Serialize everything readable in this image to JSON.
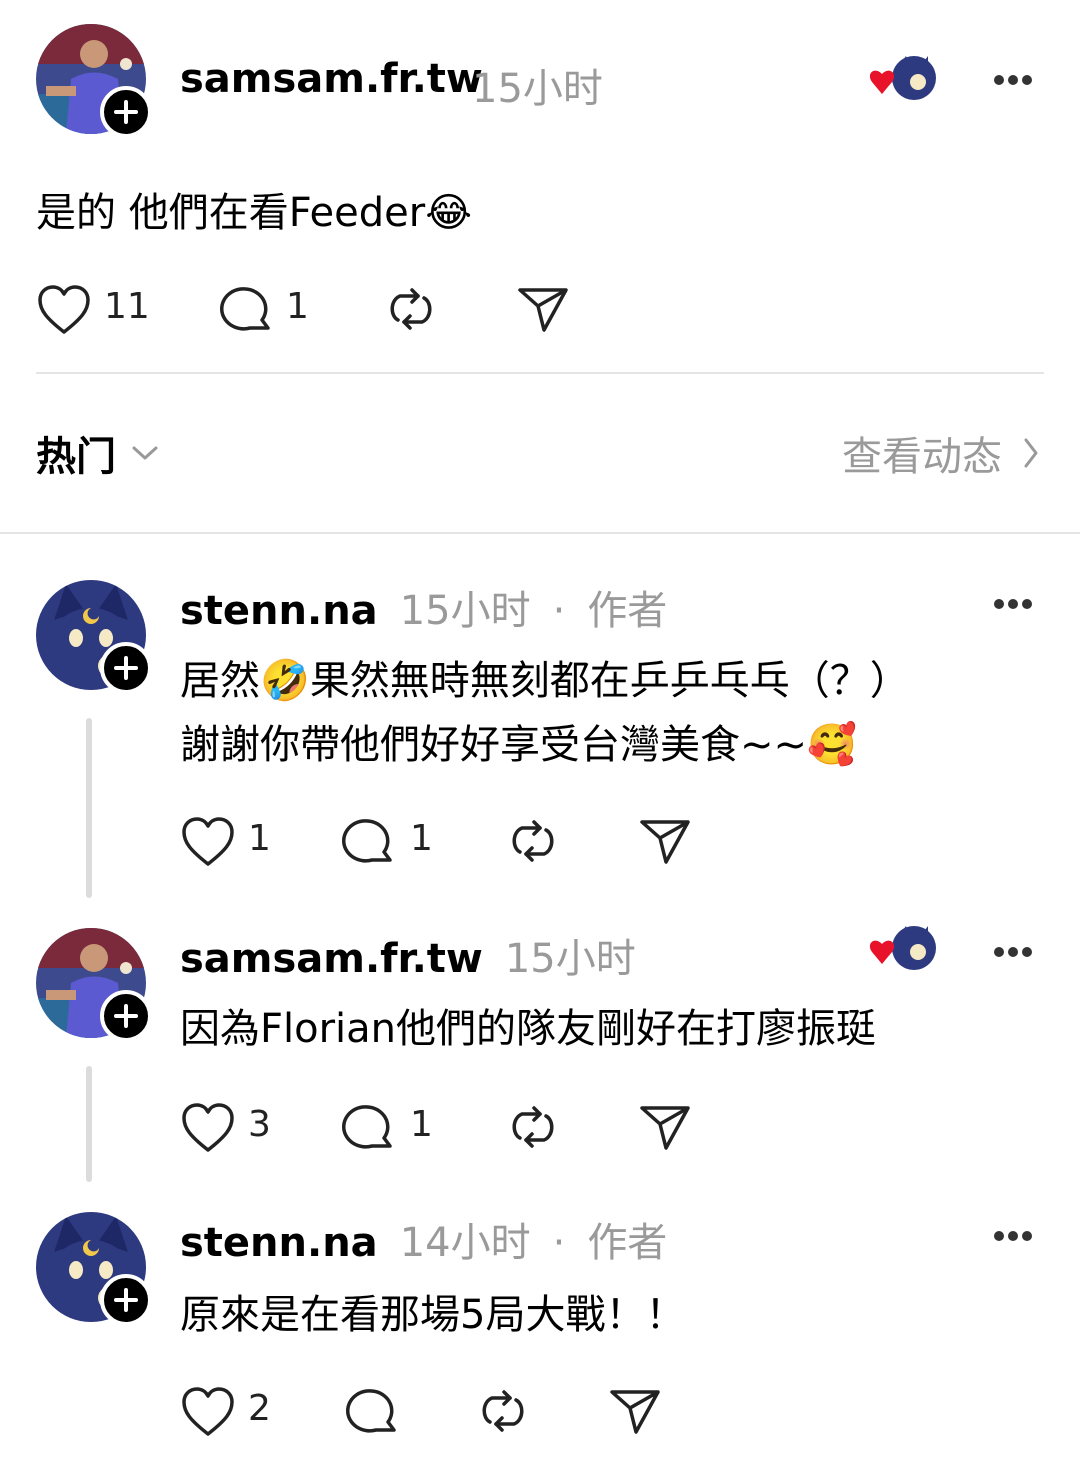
{
  "post": {
    "username": "samsam.fr.tw",
    "time": "15小时",
    "text": "是的 他們在看Feeder",
    "emoji": "😂",
    "likes": "11",
    "replies": "1"
  },
  "filter_bar": {
    "sort_label": "热门",
    "activity_label": "查看动态"
  },
  "comments": [
    {
      "username": "stenn.na",
      "time": "15小时",
      "separator": "·",
      "author_tag": "作者",
      "line1_a": "居然",
      "line1_emoji": "🤣",
      "line1_b": "果然無時無刻都在乒乒乓乓（？）",
      "line2_a": "謝謝你帶他們好好享受台灣美食~~",
      "line2_emoji": "🥰",
      "likes": "1",
      "replies": "1"
    },
    {
      "username": "samsam.fr.tw",
      "time": "15小时",
      "text": "因為Florian他們的隊友剛好在打廖振珽",
      "likes": "3",
      "replies": "1"
    },
    {
      "username": "stenn.na",
      "time": "14小时",
      "separator": "·",
      "author_tag": "作者",
      "text": "原來是在看那場5局大戰！！",
      "likes": "2"
    }
  ],
  "colors": {
    "like_heart": "#e8132b",
    "muted_text": "#9a9a9a",
    "cat_avatar_bg": "#2e3a80"
  }
}
